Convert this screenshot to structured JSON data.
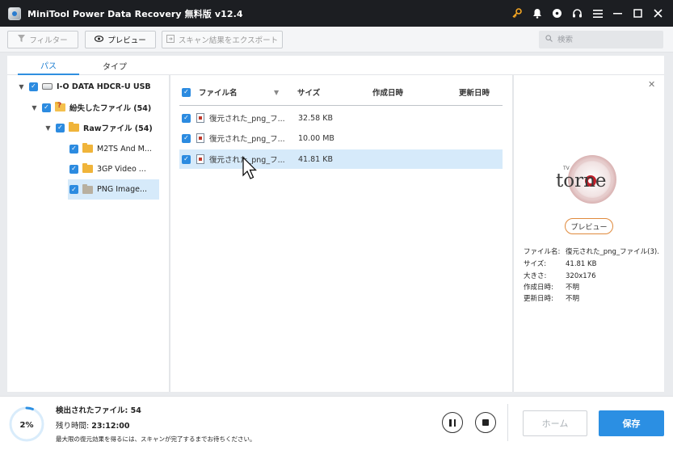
{
  "window": {
    "title": "MiniTool Power Data Recovery 無料版 v12.4",
    "controls": [
      "key-icon",
      "bell-icon",
      "disc-icon",
      "headset-icon",
      "menu-icon",
      "minimize-icon",
      "maximize-icon",
      "close-icon"
    ]
  },
  "toolbar": {
    "filter_label": "フィルター",
    "preview_label": "プレビュー",
    "export_label": "スキャン結果をエクスポート",
    "search_placeholder": "検索"
  },
  "tabs": {
    "path": "パス",
    "type": "タイプ",
    "active": "path"
  },
  "tree": {
    "drive": "I-O DATA HDCR-U USB",
    "lost_files": "紛失したファイル (54)",
    "raw_files": "Rawファイル (54)",
    "children": [
      "M2TS And M...",
      "3GP Video ...",
      "PNG Image..."
    ],
    "selected": "PNG Image..."
  },
  "file_list": {
    "columns": {
      "name": "ファイル名",
      "size": "サイズ",
      "created": "作成日時",
      "modified": "更新日時"
    },
    "rows": [
      {
        "name": "復元された_png_フ...",
        "size": "32.58 KB",
        "selected": false
      },
      {
        "name": "復元された_png_フ...",
        "size": "10.00 MB",
        "selected": false
      },
      {
        "name": "復元された_png_フ...",
        "size": "41.81 KB",
        "selected": true
      }
    ]
  },
  "preview": {
    "logo_text": "torne",
    "logo_small": "TV",
    "button_label": "プレビュー",
    "info": [
      {
        "key": "ファイル名:",
        "value": "復元された_png_ファイル(3)."
      },
      {
        "key": "サイズ:",
        "value": "41.81 KB"
      },
      {
        "key": "大きさ:",
        "value": "320x176"
      },
      {
        "key": "作成日時:",
        "value": "不明"
      },
      {
        "key": "更新日時:",
        "value": "不明"
      }
    ]
  },
  "status": {
    "progress_label": "2%",
    "progress_value": 0.02,
    "found_label": "検出されたファイル:",
    "found_count": "54",
    "remaining_label": "残り時間:",
    "remaining_time": "23:12:00",
    "hint": "最大限の復元効果を得るには、スキャンが完了するまでお待ちください。"
  },
  "actions": {
    "home_label": "ホーム",
    "save_label": "保存"
  },
  "colors": {
    "accent": "#2b8fe3",
    "titlebar": "#1c1e22",
    "selection": "#d6eafa",
    "key_icon": "#f5a623"
  }
}
